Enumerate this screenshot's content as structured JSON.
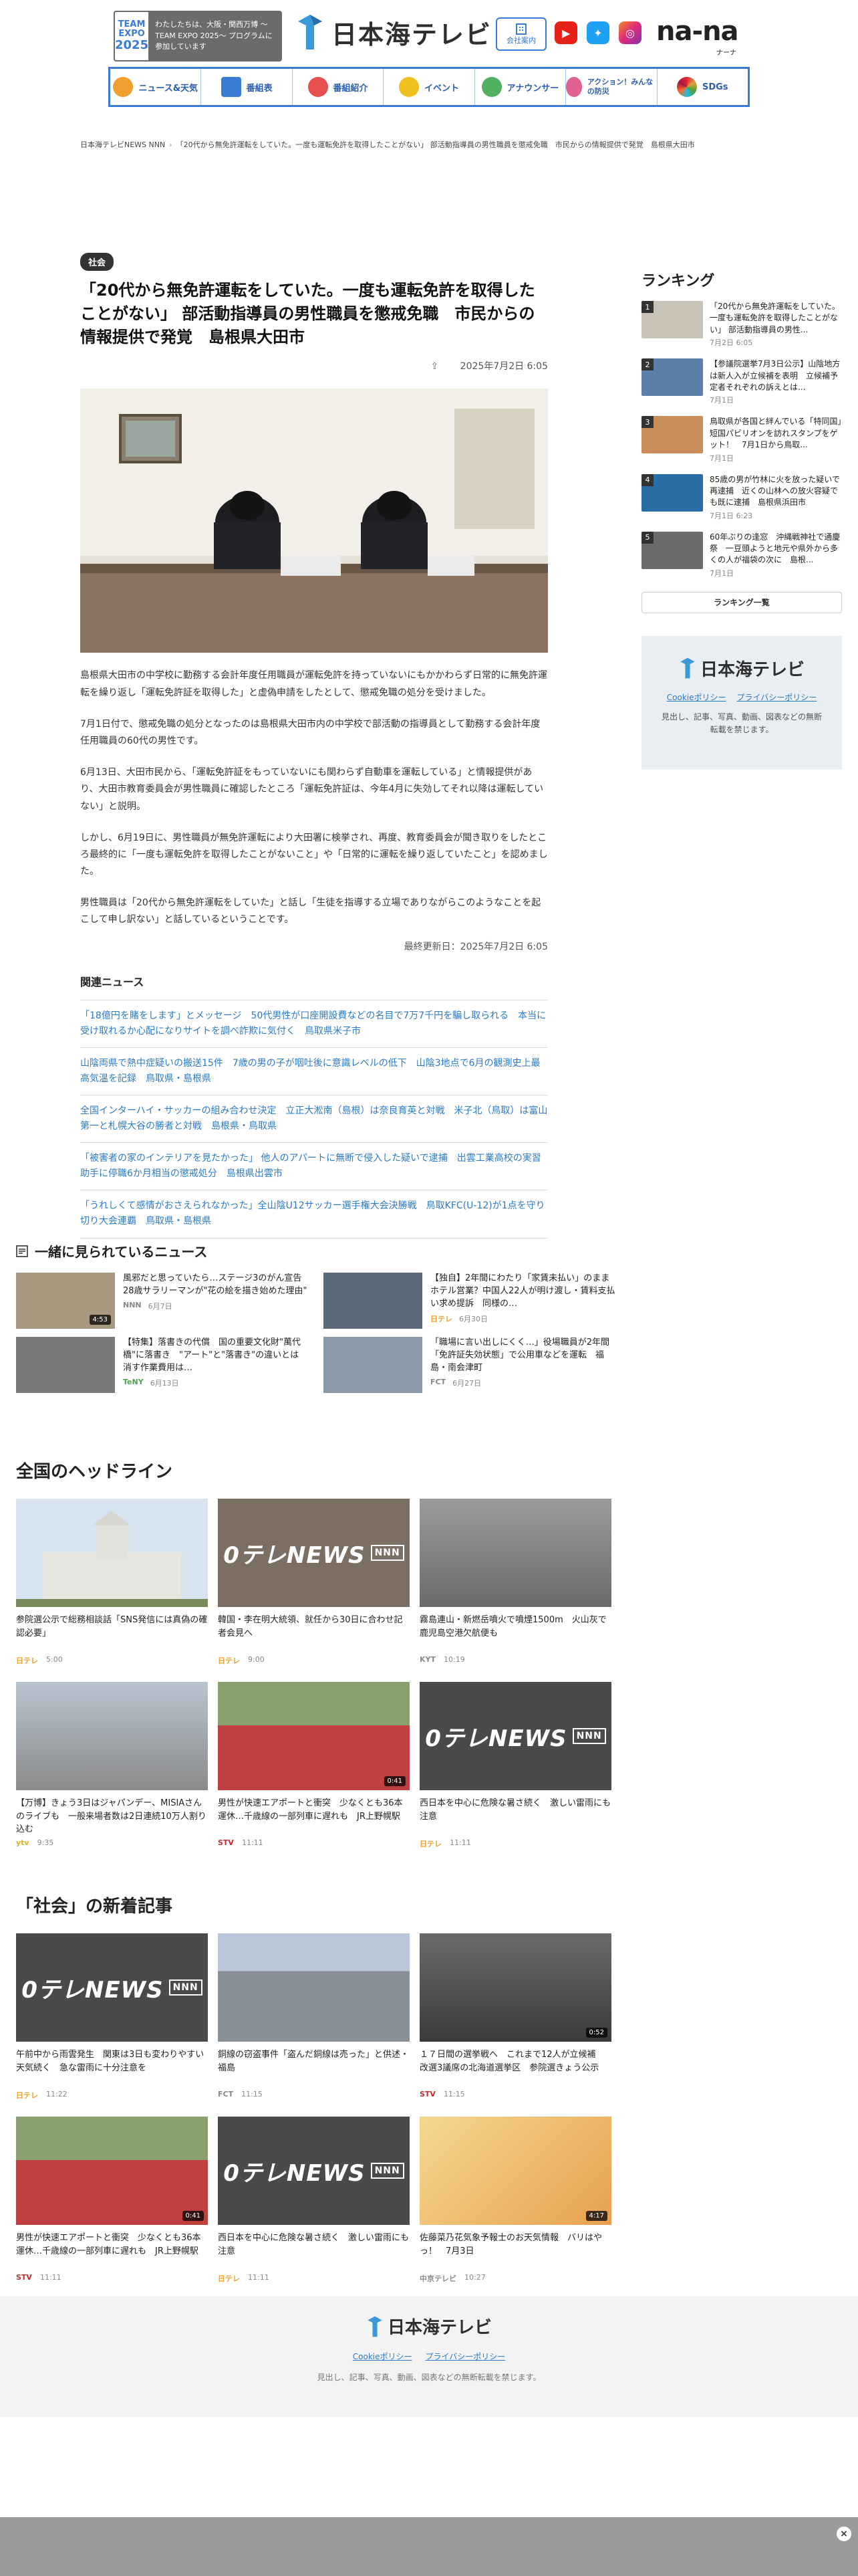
{
  "header": {
    "expo": {
      "logo_line1": "TEAM",
      "logo_line2": "EXPO",
      "logo_year": "2025",
      "text": "わたしたちは、大阪・関西万博 〜TEAM EXPO 2025〜 プログラムに参加しています"
    },
    "brand_name": "日本海テレビ",
    "company_button": "会社案内",
    "nana_logo": "na-na",
    "nana_sub": "ナーナ",
    "colors": {
      "accent": "#3a7bd5",
      "youtube": "#e62117",
      "twitter": "#1da1f2",
      "instagram": "#c13584"
    }
  },
  "nav": [
    {
      "label": "ニュース&天気",
      "icon": "news-icon",
      "color": "#f0a030"
    },
    {
      "label": "番組表",
      "icon": "grid-icon",
      "color": "#3a7bd5"
    },
    {
      "label": "番組紹介",
      "icon": "tv-icon",
      "color": "#e85050"
    },
    {
      "label": "イベント",
      "icon": "event-icon",
      "color": "#f0c020"
    },
    {
      "label": "アナウンサー",
      "icon": "mic-icon",
      "color": "#50b060"
    },
    {
      "label": "アクション！みんなの防災",
      "icon": "action-icon",
      "color": "#e06090"
    },
    {
      "label": "SDGs",
      "icon": "sdgs-icon",
      "color": "#9050c0"
    }
  ],
  "breadcrumb": [
    "日本海テレビNEWS NNN",
    "「20代から無免許運転をしていた。一度も運転免許を取得したことがない」 部活動指導員の男性職員を懲戒免職　市民からの情報提供で発覚　島根県大田市"
  ],
  "article": {
    "category": "社会",
    "title": "「20代から無免許運転をしていた。一度も運転免許を取得したことがない」 部活動指導員の男性職員を懲戒免職　市民からの情報提供で発覚　島根県大田市",
    "date": "2025年7月2日 6:05",
    "paragraphs": [
      "島根県大田市の中学校に勤務する会計年度任用職員が運転免許を持っていないにもかかわらず日常的に無免許運転を繰り返し「運転免許証を取得した」と虚偽申請をしたとして、懲戒免職の処分を受けました。",
      "7月1日付で、懲戒免職の処分となったのは島根県大田市内の中学校で部活動の指導員として勤務する会計年度任用職員の60代の男性です。",
      "6月13日、大田市民から、「運転免許証をもっていないにも関わらず自動車を運転している」と情報提供があり、大田市教育委員会が男性職員に確認したところ「運転免許証は、今年4月に失効してそれ以降は運転していない」と説明。",
      "しかし、6月19日に、男性職員が無免許運転により大田署に検挙され、再度、教育委員会が聞き取りをしたところ最終的に「一度も運転免許を取得したことがないこと」や「日常的に運転を繰り返していたこと」を認めました。",
      "男性職員は「20代から無免許運転をしていた」と話し「生徒を指導する立場でありながらこのようなことを起こして申し訳ない」と話しているということです。"
    ],
    "updated": "最終更新日：2025年7月2日 6:05",
    "related_title": "関連ニュース",
    "related": [
      "「18億円を賭をします」とメッセージ　50代男性が口座開設費などの名目で7万7千円を騙し取られる　本当に受け取れるか心配になりサイトを調べ詐欺に気付く　鳥取県米子市",
      "山陰両県で熱中症疑いの搬送15件　7歳の男の子が咽吐後に意識レベルの低下　山陰3地点で6月の観測史上最高気温を記録　鳥取県・島根県",
      "全国インターハイ・サッカーの組み合わせ決定　立正大淞南（島根）は奈良育英と対戦　米子北（鳥取）は富山第一と札幌大谷の勝者と対戦　島根県・鳥取県",
      "「被害者の家のインテリアを見たかった」 他人のアパートに無断で侵入した疑いで逮捕　出雲工業高校の実習助手に停職6か月相当の懲戒処分　島根県出雲市",
      "「うれしくて感情がおさえられなかった」全山陰U12サッカー選手権大会決勝戦　鳥取KFC(U-12)が1点を守り切り大会連覇　鳥取県・島根県"
    ]
  },
  "sidebar": {
    "ranking_title": "ランキング",
    "ranking": [
      {
        "num": "1",
        "text": "「20代から無免許運転をしていた。一度も運転免許を取得したことがない」 部活動指導員の男性...",
        "date": "7月2日 6:05",
        "color": "#c9c2b6"
      },
      {
        "num": "2",
        "text": "【参議院選挙7月3日公示】山陰地方は新人入が立候補を表明　立候補予定者それぞれの訴えとは...",
        "date": "7月1日",
        "color": "#5a7fa8"
      },
      {
        "num": "3",
        "text": "鳥取県が各国と絆んでいる「特同国」　短国パビリオンを訪れスタンプをゲット！　7月1日から鳥取...",
        "date": "7月1日",
        "color": "#c98d5a"
      },
      {
        "num": "4",
        "text": "85歳の男が竹林に火を放った疑いで再逮捕　近くの山林への放火容疑でも既に逮捕　島根県浜田市",
        "date": "7月1日 6:23",
        "color": "#2a6ea8"
      },
      {
        "num": "5",
        "text": "60年ぶりの逢窓　沖縄戦神社で通慶祭　一豆頭ようと地元や県外から多くの人が福袋の次に　島根...",
        "date": "7月1日",
        "color": "#6b6b6b"
      }
    ],
    "ranking_more": "ランキング一覧",
    "box_brand": "日本海テレビ",
    "box_links": [
      "Cookieポリシー",
      "プライバシーポリシー"
    ],
    "box_note": "見出し、記事、写真、動画、図表などの無断転載を禁じます。"
  },
  "also": {
    "title": "一緒に見られているニュース",
    "items": [
      {
        "text": "風邪だと思っていたら…ステージ3のがん宣告　28歳サラリーマンが\"花の絵を描き始めた理由\"",
        "source": "NNN",
        "date": "6月7日",
        "color": "#a89880",
        "dur": "4:53"
      },
      {
        "text": "【独自】2年間にわたり「家賃未払い」のままホテル営業？中国人22人が明け渡し・賃料支払い求め提訴　同様の…",
        "source": "日テレ",
        "date": "6月30日",
        "color": "#5a6a7a",
        "dur": ""
      },
      {
        "text": "【特集】落書きの代償　国の重要文化財\"萬代橋\"に落書き　\"アート\"と\"落書き\"の違いとは　消す作業費用は…",
        "source": "TeNY",
        "date": "6月13日",
        "color": "#7a7a7a",
        "dur": ""
      },
      {
        "text": "「職場に言い出しにくく…」役場職員が2年間「免許証失効状態」で公用車などを運転　福島・南会津町",
        "source": "FCT",
        "date": "6月27日",
        "color": "#8a9aa8",
        "dur": ""
      }
    ]
  },
  "headlines": {
    "title": "全国のヘッドライン",
    "items": [
      {
        "title": "参院選公示で総務相談話「SNS発信には真偽の確認必要」",
        "source": "日テレ",
        "time": "5:00",
        "thumb": "#c8d4e0",
        "dur": ""
      },
      {
        "title": "韓国・李在明大統領、就任から30日に合わせ記者会見へ",
        "source": "日テレ",
        "time": "9:00",
        "thumb": "#b0a090",
        "dur": ""
      },
      {
        "title": "霧島連山・新燃岳噴火で噴煙1500m　火山灰で鹿児島空港欠航便も",
        "source": "KYT",
        "time": "10:19",
        "thumb": "#8a8a8a",
        "dur": ""
      },
      {
        "title": "【万博】きょう3日はジャパンデー、MISIAさんのライブも　一般来場者数は2日連続10万人割り込む",
        "source": "ytv",
        "time": "9:35",
        "thumb": "#9aa0a8",
        "dur": ""
      },
      {
        "title": "男性が快速エアポートと衝突　少なくとも36本運休…千歳線の一部列車に遅れも　JR上野幌駅",
        "source": "STV",
        "time": "11:11",
        "thumb": "#c04040",
        "dur": "0:41"
      },
      {
        "title": "西日本を中心に危険な暑さ続く　激しい雷雨にも注意",
        "source": "日テレ",
        "time": "11:11",
        "thumb": "#4a4a4a",
        "dur": ""
      }
    ]
  },
  "shakai": {
    "title": "「社会」の新着記事",
    "items": [
      {
        "title": "午前中から雨雲発生　関東は3日も変わりやすい天気続く　急な雷雨に十分注意を",
        "source": "日テレ",
        "time": "11:22",
        "thumb": "#4a4a4a",
        "dur": ""
      },
      {
        "title": "銅線の窃盗事件「盗んだ銅線は売った」と供述・福島",
        "source": "FCT",
        "time": "11:15",
        "thumb": "#8a9098",
        "dur": ""
      },
      {
        "title": "１７日間の選挙戦へ　これまで12人が立候補　改選3議席の北海道選挙区　参院選きょう公示",
        "source": "STV",
        "time": "11:15",
        "thumb": "#5a5a5a",
        "dur": "0:52"
      },
      {
        "title": "男性が快速エアポートと衝突　少なくとも36本運休…千歳線の一部列車に遅れも　JR上野幌駅",
        "source": "STV",
        "time": "11:11",
        "thumb": "#c04040",
        "dur": "0:41"
      },
      {
        "title": "西日本を中心に危険な暑さ続く　激しい雷雨にも注意",
        "source": "日テレ",
        "time": "11:11",
        "thumb": "#4a4a4a",
        "dur": ""
      },
      {
        "title": "佐藤菜乃花気象予報士のお天気情報　バリはやっ！　7月3日",
        "source": "中京テレビ",
        "time": "10:27",
        "thumb": "#e8c070",
        "dur": "4:17"
      }
    ]
  },
  "footer": {
    "brand": "日本海テレビ",
    "links": [
      "Cookieポリシー",
      "プライバシーポリシー"
    ],
    "note": "見出し、記事、写真、動画、図表などの無断転載を禁じます。"
  },
  "bottom_bar": {
    "close_glyph": "×"
  }
}
